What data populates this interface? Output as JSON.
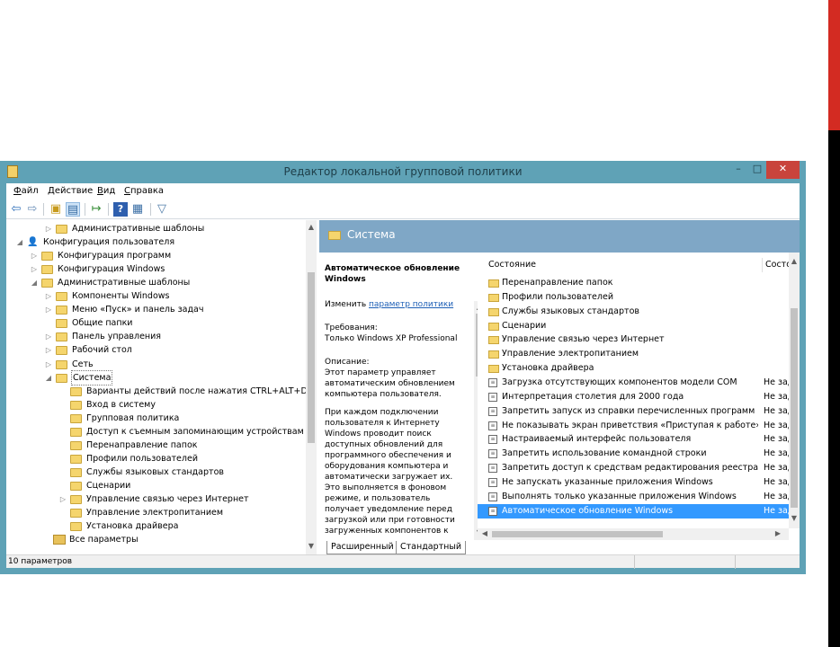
{
  "window": {
    "title": "Редактор локальной групповой политики",
    "minimize": "–",
    "maximize": "□",
    "close": "✕"
  },
  "menu": [
    "Файл",
    "Действие",
    "Вид",
    "Справка"
  ],
  "menu_underline": [
    "Ф",
    "Д",
    "В",
    "С"
  ],
  "tree": [
    {
      "label": "Административные шаблоны",
      "indent": 2,
      "twisty": "▷",
      "icon": "folder"
    },
    {
      "label": "Конфигурация пользователя",
      "indent": 0,
      "twisty": "◢",
      "icon": "user"
    },
    {
      "label": "Конфигурация программ",
      "indent": 1,
      "twisty": "▷",
      "icon": "folder"
    },
    {
      "label": "Конфигурация Windows",
      "indent": 1,
      "twisty": "▷",
      "icon": "folder"
    },
    {
      "label": "Административные шаблоны",
      "indent": 1,
      "twisty": "◢",
      "icon": "folder"
    },
    {
      "label": "Компоненты Windows",
      "indent": 2,
      "twisty": "▷",
      "icon": "folder"
    },
    {
      "label": "Меню «Пуск» и панель задач",
      "indent": 2,
      "twisty": "▷",
      "icon": "folder"
    },
    {
      "label": "Общие папки",
      "indent": 2,
      "twisty": "",
      "icon": "folder"
    },
    {
      "label": "Панель управления",
      "indent": 2,
      "twisty": "▷",
      "icon": "folder"
    },
    {
      "label": "Рабочий стол",
      "indent": 2,
      "twisty": "▷",
      "icon": "folder"
    },
    {
      "label": "Сеть",
      "indent": 2,
      "twisty": "▷",
      "icon": "folder"
    },
    {
      "label": "Система",
      "indent": 2,
      "twisty": "◢",
      "icon": "folder",
      "selected": true
    },
    {
      "label": "Варианты действий после нажатия CTRL+ALT+DEL",
      "indent": 3,
      "twisty": "",
      "icon": "folder"
    },
    {
      "label": "Вход в систему",
      "indent": 3,
      "twisty": "",
      "icon": "folder"
    },
    {
      "label": "Групповая политика",
      "indent": 3,
      "twisty": "",
      "icon": "folder"
    },
    {
      "label": "Доступ к съемным запоминающим устройствам",
      "indent": 3,
      "twisty": "",
      "icon": "folder"
    },
    {
      "label": "Перенаправление папок",
      "indent": 3,
      "twisty": "",
      "icon": "folder"
    },
    {
      "label": "Профили пользователей",
      "indent": 3,
      "twisty": "",
      "icon": "folder"
    },
    {
      "label": "Службы языковых стандартов",
      "indent": 3,
      "twisty": "",
      "icon": "folder"
    },
    {
      "label": "Сценарии",
      "indent": 3,
      "twisty": "",
      "icon": "folder"
    },
    {
      "label": "Управление связью через Интернет",
      "indent": 3,
      "twisty": "▷",
      "icon": "folder"
    },
    {
      "label": "Управление электропитанием",
      "indent": 3,
      "twisty": "",
      "icon": "folder"
    },
    {
      "label": "Установка драйвера",
      "indent": 3,
      "twisty": "",
      "icon": "folder"
    },
    {
      "label": "Все параметры",
      "indent": 1,
      "twisty": "",
      "icon": "allparams"
    }
  ],
  "right_header": {
    "title": "Система"
  },
  "description": {
    "title": "Автоматическое обновление Windows",
    "edit_prefix": "Изменить ",
    "edit_link": "параметр политики",
    "requirements_label": "Требования:",
    "requirements_value": "Только Windows XP Professional",
    "description_label": "Описание:",
    "para1": "Этот параметр управляет автоматическим обновлением компьютера пользователя.",
    "para2": "При каждом подключении пользователя к Интернету Windows проводит поиск доступных обновлений для программного обеспечения и оборудования компьютера и автоматически загружает их. Это выполняется в фоновом режиме, и пользователь получает уведомление перед загрузкой или при готовности загруженных компонентов к"
  },
  "list": {
    "col_state": "Состояние",
    "col_status": "Состояние",
    "rows": [
      {
        "name": "Перенаправление папок",
        "status": "",
        "icon": "folder"
      },
      {
        "name": "Профили пользователей",
        "status": "",
        "icon": "folder"
      },
      {
        "name": "Службы языковых стандартов",
        "status": "",
        "icon": "folder"
      },
      {
        "name": "Сценарии",
        "status": "",
        "icon": "folder"
      },
      {
        "name": "Управление связью через Интернет",
        "status": "",
        "icon": "folder"
      },
      {
        "name": "Управление электропитанием",
        "status": "",
        "icon": "folder"
      },
      {
        "name": "Установка драйвера",
        "status": "",
        "icon": "folder"
      },
      {
        "name": "Загрузка отсутствующих компонентов модели COM",
        "status": "Не зад",
        "icon": "setting"
      },
      {
        "name": "Интерпретация столетия для 2000 года",
        "status": "Не зад",
        "icon": "setting"
      },
      {
        "name": "Запретить запуск из справки перечисленных программ",
        "status": "Не зад",
        "icon": "setting"
      },
      {
        "name": "Не показывать экран приветствия «Приступая к работе» ...",
        "status": "Не зад",
        "icon": "setting"
      },
      {
        "name": "Настраиваемый интерфейс пользователя",
        "status": "Не зад",
        "icon": "setting"
      },
      {
        "name": "Запретить использование командной строки",
        "status": "Не зад",
        "icon": "setting"
      },
      {
        "name": "Запретить доступ к средствам редактирования реестра",
        "status": "Не зад",
        "icon": "setting"
      },
      {
        "name": "Не запускать указанные приложения Windows",
        "status": "Не зад",
        "icon": "setting"
      },
      {
        "name": "Выполнять только указанные приложения Windows",
        "status": "Не зад",
        "icon": "setting"
      },
      {
        "name": "Автоматическое обновление Windows",
        "status": "Не зад",
        "icon": "setting",
        "selected": true
      }
    ]
  },
  "tabs": [
    "Расширенный",
    "Стандартный"
  ],
  "statusbar": {
    "text": "10 параметров"
  },
  "icons": {
    "back": "back-arrow-icon",
    "forward": "forward-arrow-icon",
    "up": "up-folder-icon",
    "show-hide": "show-hide-tree-icon",
    "export": "export-list-icon",
    "help": "help-icon",
    "properties": "properties-icon",
    "filter": "filter-icon"
  },
  "colors": {
    "window_frame": "#5fa2b6",
    "header_band": "#7fa7c6",
    "selection": "#3399ff",
    "close_button": "#c9443c",
    "accent_red": "#d32b22"
  }
}
